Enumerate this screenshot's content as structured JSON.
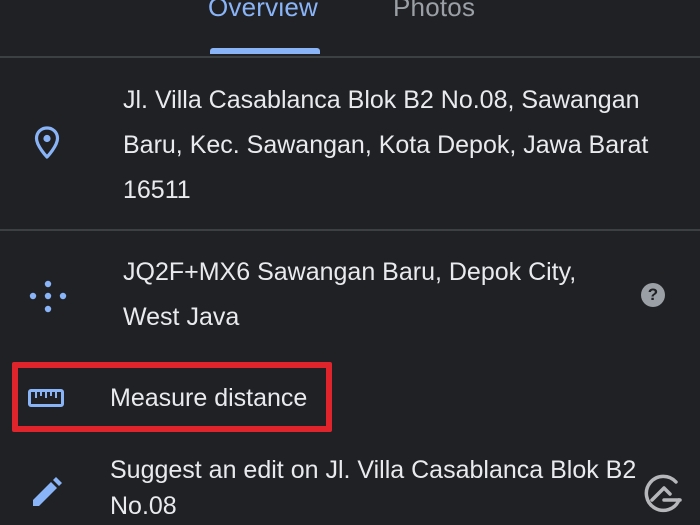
{
  "tabs": [
    {
      "label": "Overview",
      "active": true
    },
    {
      "label": "Photos",
      "active": false
    }
  ],
  "address": {
    "icon": "location-pin-icon",
    "line1": "Jl. Villa Casablanca Blok B2 No.08, Sawangan",
    "line2": "Baru, Kec. Sawangan, Kota Depok, Jawa Barat",
    "line3": "16511"
  },
  "plus_code": {
    "icon": "plus-code-icon",
    "line1": "JQ2F+MX6 Sawangan Baru, Depok City,",
    "line2": "West Java",
    "help_icon": "help-icon",
    "help_glyph": "?"
  },
  "measure": {
    "icon": "ruler-icon",
    "label": "Measure distance"
  },
  "suggest_edit": {
    "icon": "pencil-icon",
    "line1": "Suggest an edit on Jl. Villa Casablanca Blok B2",
    "line2": "No.08"
  },
  "watermark": {
    "icon": "watermark-logo-icon"
  },
  "colors": {
    "background": "#202124",
    "accent": "#8ab4f8",
    "text": "#e8eaed",
    "muted": "#9aa0a6",
    "highlight": "#e0242b",
    "divider": "#3c4043"
  }
}
